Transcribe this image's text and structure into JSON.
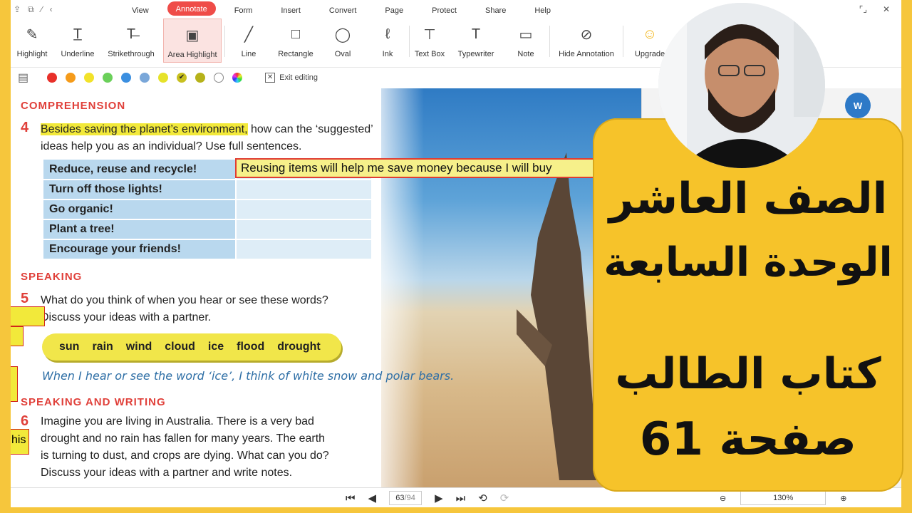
{
  "menu": {
    "items": [
      "View",
      "Annotate",
      "Form",
      "Insert",
      "Convert",
      "Page",
      "Protect",
      "Share",
      "Help"
    ],
    "active": "Annotate"
  },
  "ribbon": {
    "tools": [
      {
        "label": "Highlight",
        "icon": "highlight-icon",
        "glyph": "✎"
      },
      {
        "label": "Underline",
        "icon": "underline-icon",
        "glyph": "T̲"
      },
      {
        "label": "Strikethrough",
        "icon": "strikethrough-icon",
        "glyph": "T̶"
      },
      {
        "label": "Area Highlight",
        "icon": "area-highlight-icon",
        "glyph": "▣"
      },
      {
        "label": "Line",
        "icon": "line-icon",
        "glyph": "╱"
      },
      {
        "label": "Rectangle",
        "icon": "rectangle-icon",
        "glyph": "□"
      },
      {
        "label": "Oval",
        "icon": "oval-icon",
        "glyph": "◯"
      },
      {
        "label": "Ink",
        "icon": "ink-icon",
        "glyph": "ℓ"
      },
      {
        "label": "Text Box",
        "icon": "text-box-icon",
        "glyph": "⊤"
      },
      {
        "label": "Typewriter",
        "icon": "typewriter-icon",
        "glyph": "T"
      },
      {
        "label": "Note",
        "icon": "note-icon",
        "glyph": "▭"
      },
      {
        "label": "Hide Annotation",
        "icon": "hide-annotation-icon",
        "glyph": "⊘"
      },
      {
        "label": "Upgrade",
        "icon": "upgrade-icon",
        "glyph": "☺"
      }
    ]
  },
  "colorbar": {
    "colors": [
      "#e8302a",
      "#f59b1a",
      "#f2e22a",
      "#6bd05a",
      "#3b8fe0",
      "#7aa7d9",
      "#e6e22a",
      "#c8c020",
      "#b6b21a",
      "#ffffff"
    ],
    "exit_label": "Exit editing"
  },
  "document": {
    "comprehension_heading": "COMPREHENSION",
    "q4_num": "4",
    "q4_highlight": "Besides saving the planet’s environment,",
    "q4_rest": " how can the ‘suggested’",
    "q4_line2": "ideas help you as an individual? Use full sentences.",
    "table_rows": [
      "Reduce, reuse and recycle!",
      "Turn off those lights!",
      "Go organic!",
      "Plant a tree!",
      "Encourage your friends!"
    ],
    "answer_text": "Reusing items will help me save money because I will buy",
    "speaking_heading": "SPEAKING",
    "q5_num": "5",
    "q5_line1": "What do you think of when you hear or see these words?",
    "q5_line2": "Discuss your ideas with a partner.",
    "words": [
      "sun",
      "rain",
      "wind",
      "cloud",
      "ice",
      "flood",
      "drought"
    ],
    "example": "When I hear or see the word ‘ice’, I think of white snow and polar bears.",
    "sw_heading": "SPEAKING AND WRITING",
    "q6_num": "6",
    "q6_lines": [
      "Imagine you are living in Australia. There is a very bad",
      "drought and no rain has fallen for many years. The earth",
      "is turning to dust, and crops are dying. What can you do?",
      "Discuss your ideas with a partner and write notes."
    ],
    "margin_note_text": "his"
  },
  "statusbar": {
    "page": "63",
    "total": "/94",
    "zoom": "130%"
  },
  "overlay": {
    "line1": "الصف العاشر",
    "line2": "الوحدة السابعة",
    "line3": "كتاب الطالب",
    "line4": "صفحة 61"
  }
}
